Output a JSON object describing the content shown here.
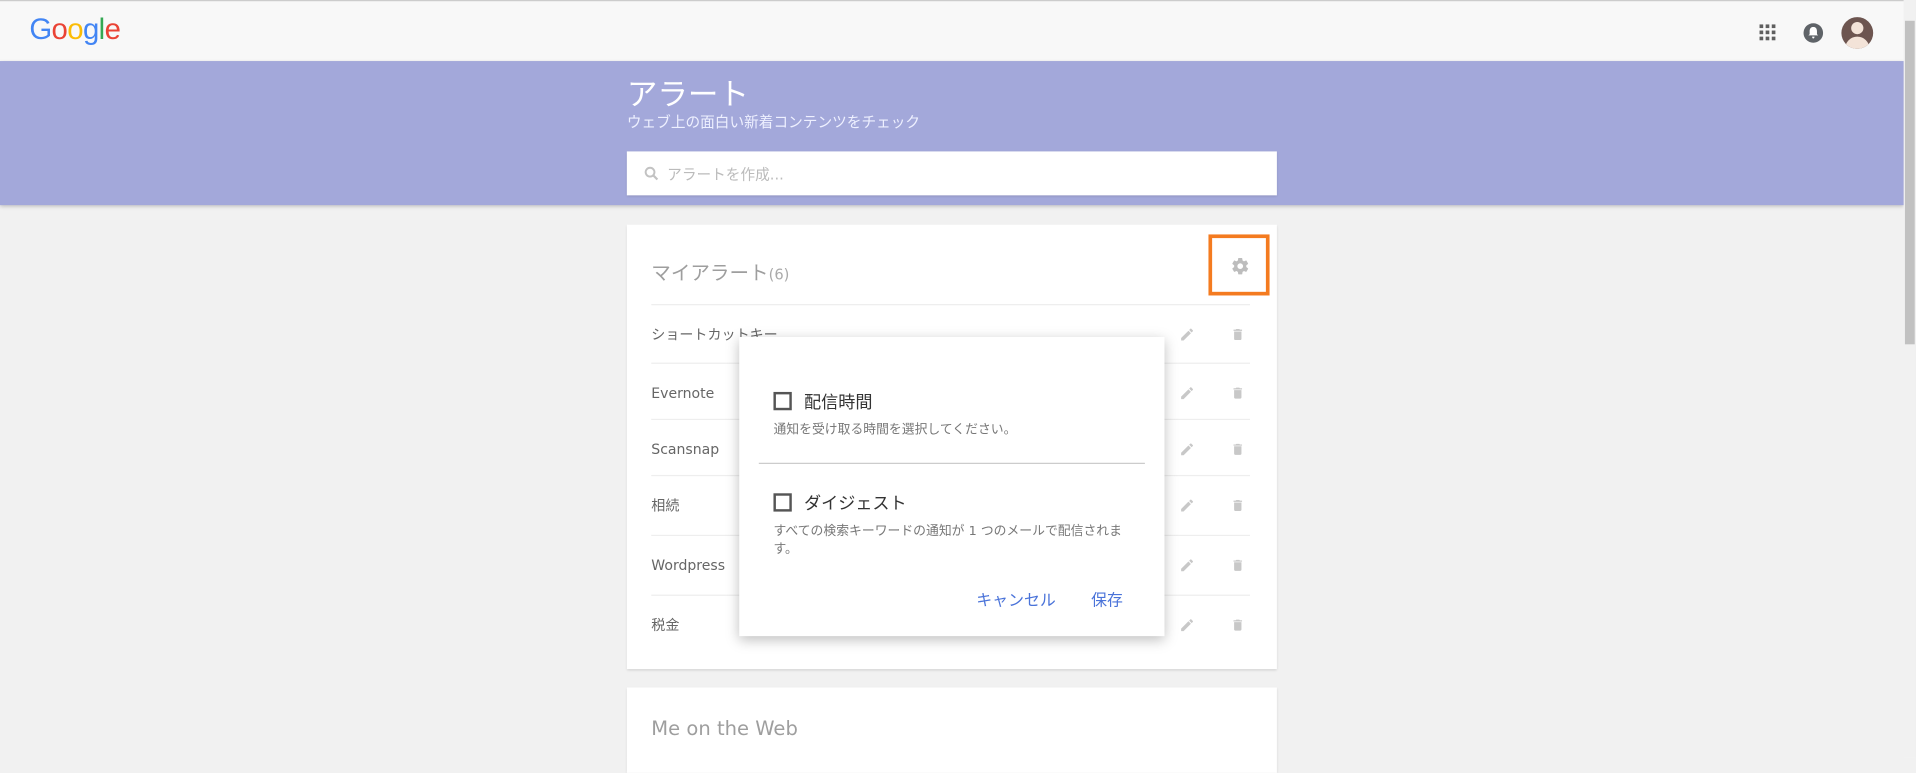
{
  "header": {
    "logo_letters": [
      {
        "ch": "G",
        "color": "#4285F4"
      },
      {
        "ch": "o",
        "color": "#EA4335"
      },
      {
        "ch": "o",
        "color": "#FBBC05"
      },
      {
        "ch": "g",
        "color": "#4285F4"
      },
      {
        "ch": "l",
        "color": "#34A853"
      },
      {
        "ch": "e",
        "color": "#EA4335"
      }
    ]
  },
  "banner": {
    "title": "アラート",
    "subtitle": "ウェブ上の面白い新着コンテンツをチェック",
    "search_placeholder": "アラートを作成..."
  },
  "my_alerts": {
    "title": "マイアラート",
    "count": "(6)",
    "items": [
      {
        "label": "ショートカットキー"
      },
      {
        "label": "Evernote"
      },
      {
        "label": "Scansnap"
      },
      {
        "label": "相続"
      },
      {
        "label": "Wordpress　プ"
      },
      {
        "label": "税金"
      }
    ]
  },
  "me_on_web": {
    "title": "Me on the Web"
  },
  "settings_dialog": {
    "delivery_time": {
      "label": "配信時間",
      "description": "通知を受け取る時間を選択してください。",
      "checked": false
    },
    "digest": {
      "label": "ダイジェスト",
      "description": "すべての検索キーワードの通知が 1 つのメールで配信されます。",
      "checked": false
    },
    "cancel_label": "キャンセル",
    "save_label": "保存"
  },
  "colors": {
    "banner": "#a3a8da",
    "highlight": "#f47b20",
    "link": "#4a73d9"
  },
  "icons": [
    "apps-icon",
    "notification-bell-icon",
    "avatar",
    "search-icon",
    "gear-icon",
    "edit-icon",
    "trash-icon"
  ]
}
